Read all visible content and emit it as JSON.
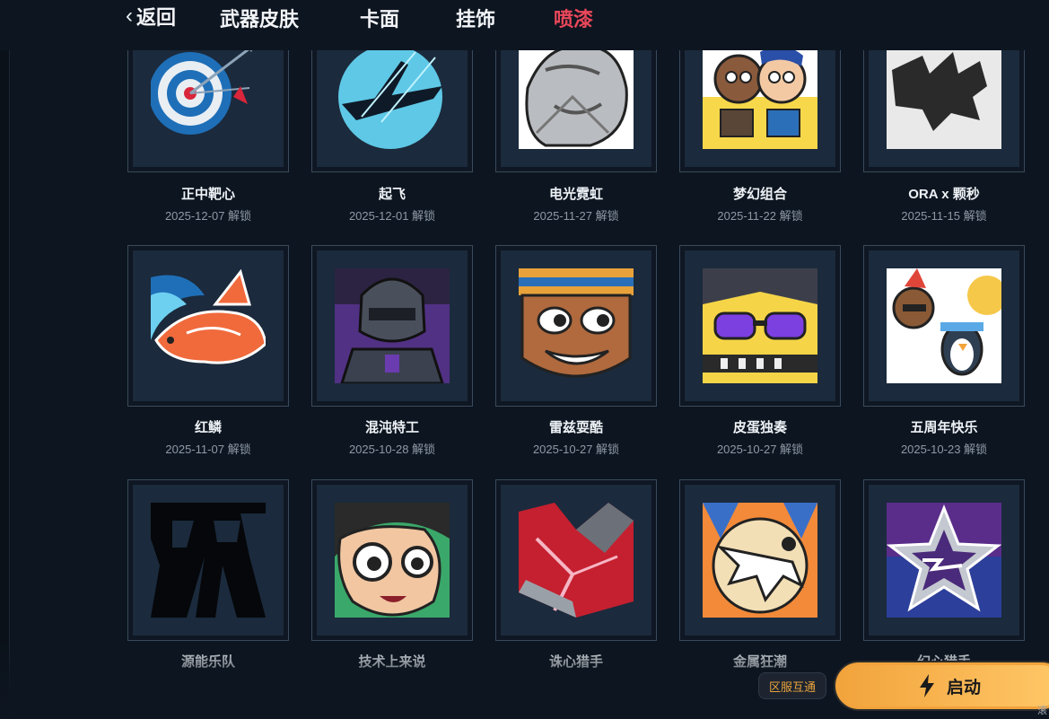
{
  "nav": {
    "back_label": "返回",
    "tabs": [
      {
        "label": "武器皮肤",
        "active": false
      },
      {
        "label": "卡面",
        "active": false
      },
      {
        "label": "挂饰",
        "active": false
      },
      {
        "label": "喷漆",
        "active": true
      }
    ]
  },
  "unlock_suffix": "解锁",
  "sprays": [
    {
      "name": "正中靶心",
      "date": "2025-12-07 解锁",
      "art": "bullseye"
    },
    {
      "name": "起飞",
      "date": "2025-12-01 解锁",
      "art": "takeoff"
    },
    {
      "name": "电光霓虹",
      "date": "2025-11-27 解锁",
      "art": "neon"
    },
    {
      "name": "梦幻组合",
      "date": "2025-11-22 解锁",
      "art": "duo"
    },
    {
      "name": "ORA x 颗秒",
      "date": "2025-11-15 解锁",
      "art": "rhino"
    },
    {
      "name": "红鳞",
      "date": "2025-11-07 解锁",
      "art": "koi"
    },
    {
      "name": "混沌特工",
      "date": "2025-10-28 解锁",
      "art": "agent"
    },
    {
      "name": "雷兹耍酷",
      "date": "2025-10-27 解锁",
      "art": "raze"
    },
    {
      "name": "皮蛋独奏",
      "date": "2025-10-27 解锁",
      "art": "keytar"
    },
    {
      "name": "五周年快乐",
      "date": "2025-10-23 解锁",
      "art": "anniversary"
    },
    {
      "name": "源能乐队",
      "date": "",
      "art": "band"
    },
    {
      "name": "技术上来说",
      "date": "",
      "art": "nerd"
    },
    {
      "name": "诛心猎手",
      "date": "",
      "art": "hunter"
    },
    {
      "name": "金属狂潮",
      "date": "",
      "art": "metal"
    },
    {
      "name": "幻心猎手",
      "date": "",
      "art": "star"
    }
  ],
  "footer": {
    "region_badge": "区服互通",
    "launch_label": "启动",
    "launch_icon": "lightning-icon",
    "corner_text": "滚"
  },
  "colors": {
    "active_tab": "#e9475a",
    "launch_button": "#f2a33b",
    "region_text": "#e8a33a"
  }
}
